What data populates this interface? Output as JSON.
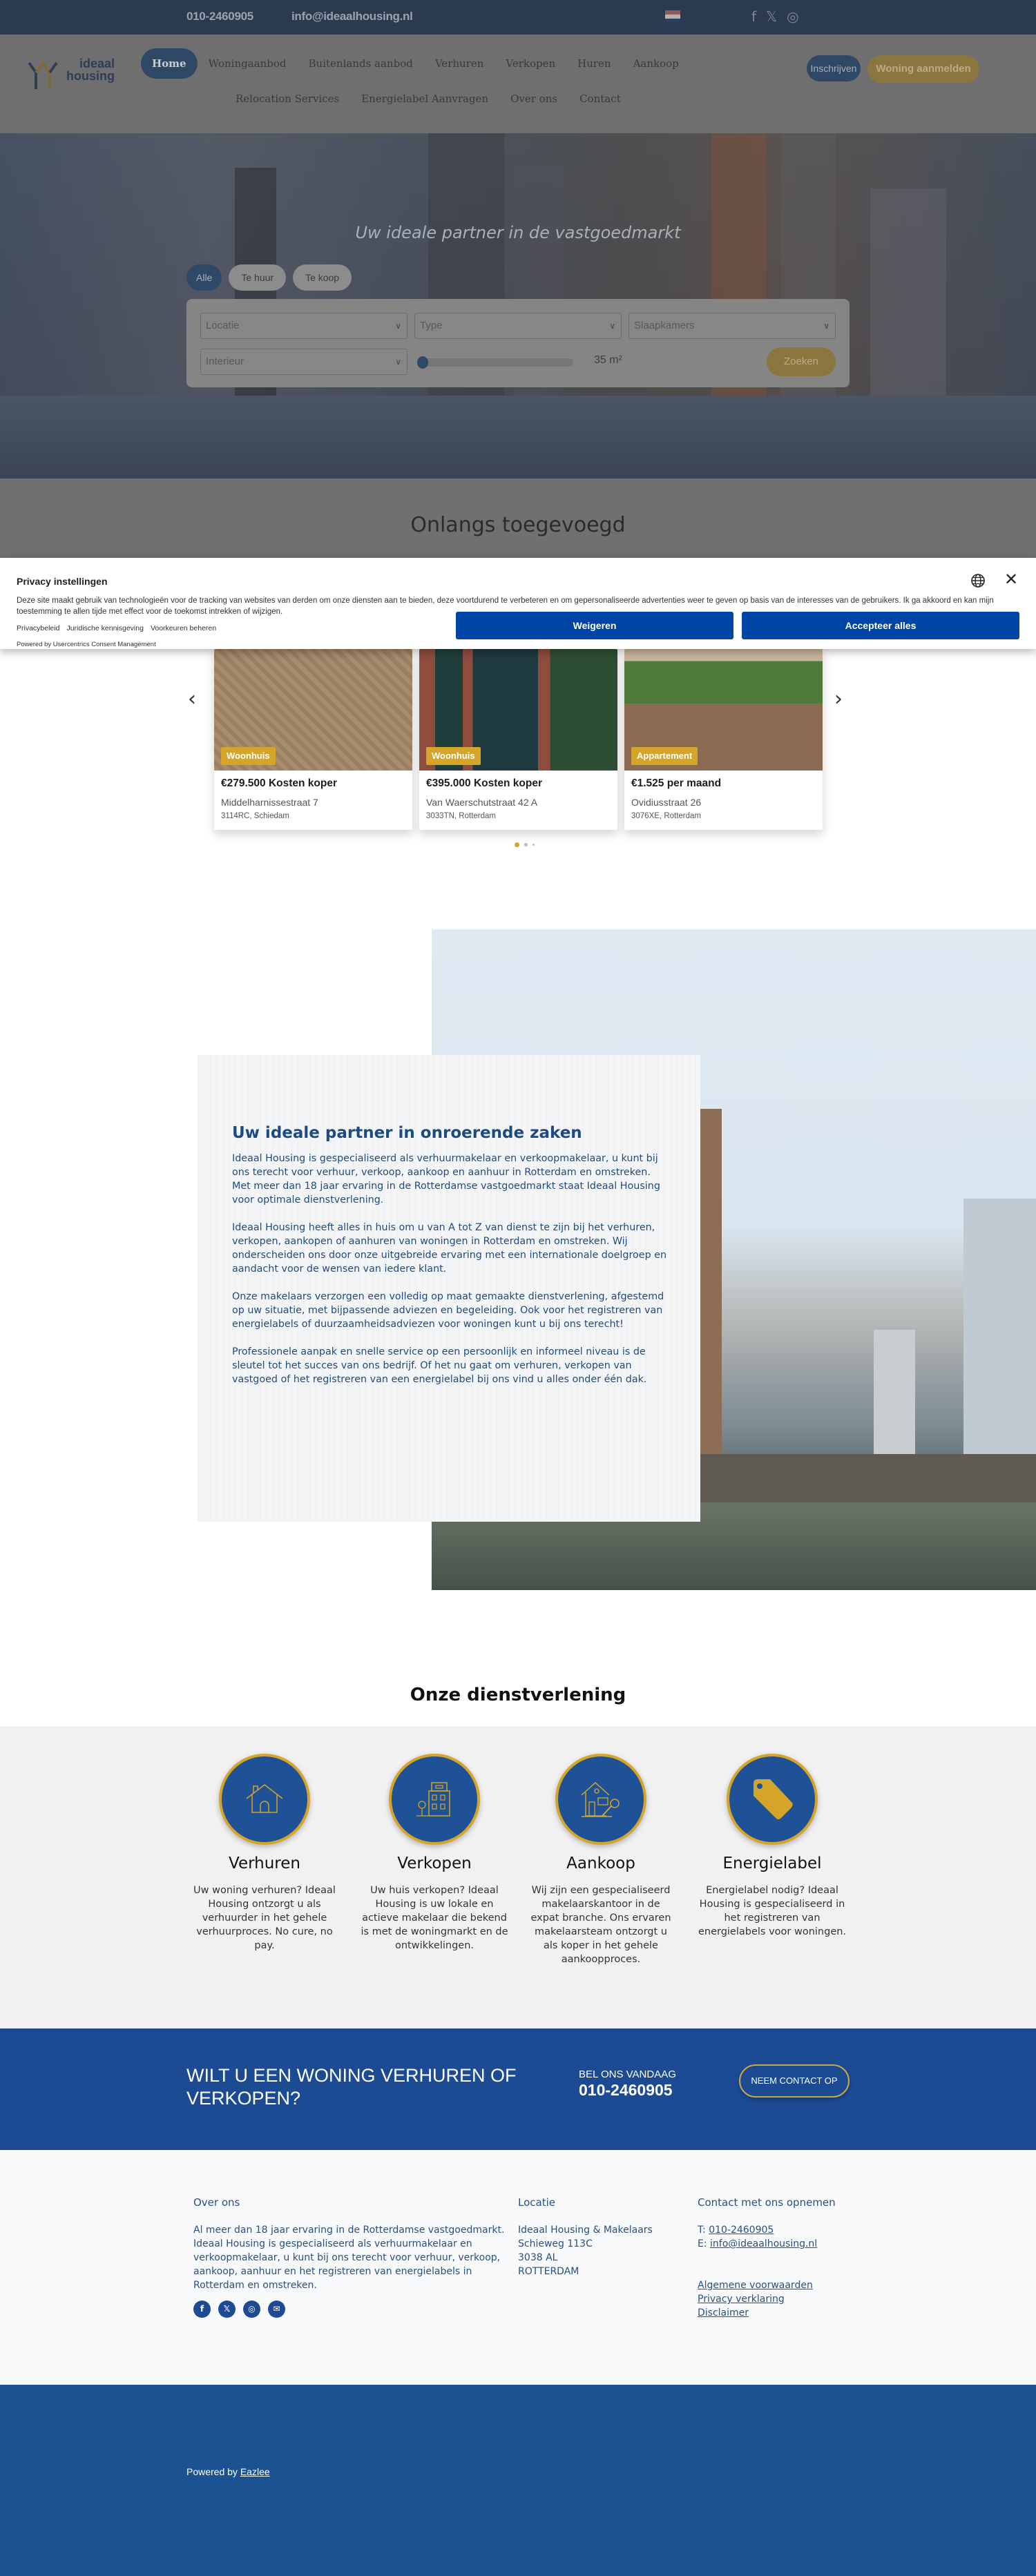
{
  "topbar": {
    "phone": "010-2460905",
    "email": "info@ideaalhousing.nl",
    "language_flag": "dutch-flag",
    "social": [
      {
        "name": "facebook",
        "glyph": "f"
      },
      {
        "name": "x",
        "glyph": "𝕏"
      },
      {
        "name": "instagram",
        "glyph": "◎"
      }
    ]
  },
  "header": {
    "logo_line1": "ideaal",
    "logo_line2": "housing",
    "nav_main": [
      "Home",
      "Woningaanbod",
      "Buitenlands aanbod",
      "Verhuren",
      "Verkopen",
      "Huren",
      "Aankoop"
    ],
    "nav_sub": [
      "Relocation Services",
      "Energielabel Aanvragen",
      "Over ons",
      "Contact"
    ],
    "active_nav": "Home",
    "btn_inschrijven": "Inschrijven",
    "btn_aanmelden": "Woning aanmelden"
  },
  "hero": {
    "title": "Uw ideale partner in de vastgoedmarkt",
    "tabs": [
      "Alle",
      "Te huur",
      "Te koop"
    ],
    "active_tab": "Alle",
    "filters": {
      "location_placeholder": "Locatie",
      "type_placeholder": "Type",
      "bedrooms_placeholder": "Slaapkamers",
      "interior_placeholder": "Interieur",
      "area_value": "35 m²",
      "search_label": "Zoeken"
    }
  },
  "recent": {
    "title": "Onlangs toegevoegd",
    "listings": [
      {
        "badge": "Woonhuis",
        "price": "€279.500 Kosten koper",
        "street": "Middelharnissestraat 7",
        "city": "3114RC, Schiedam"
      },
      {
        "badge": "Woonhuis",
        "price": "€395.000 Kosten koper",
        "street": "Van Waerschutstraat 42 A",
        "city": "3033TN, Rotterdam"
      },
      {
        "badge": "Appartement",
        "price": "€1.525 per maand",
        "street": "Ovidiusstraat 26",
        "city": "3076XE, Rotterdam"
      }
    ],
    "carousel_pages": 3,
    "carousel_active": 1
  },
  "consent": {
    "title": "Privacy instellingen",
    "text": "Deze site maakt gebruik van technologieën voor de tracking van websites van derden om onze diensten aan te bieden, deze voortdurend te verbeteren en om gepersonaliseerde advertenties weer te geven op basis van de interesses van de gebruikers. Ik ga akkoord en kan mijn toestemming te allen tijde met effect voor de toekomst intrekken of wijzigen.",
    "links": [
      "Privacybeleid",
      "Juridische kennisgeving",
      "Voorkeuren beheren"
    ],
    "powered": "Powered by Usercentrics Consent Management",
    "deny_label": "Weigeren",
    "accept_label": "Accepteer alles"
  },
  "about": {
    "title": "Uw ideale partner in onroerende zaken",
    "paragraphs": [
      "Ideaal Housing is gespecialiseerd als verhuurmakelaar en verkoopmakelaar, u kunt bij ons terecht voor verhuur, verkoop, aankoop en aanhuur in Rotterdam en omstreken. Met meer dan 18 jaar ervaring in de Rotterdamse vastgoedmarkt staat Ideaal Housing voor optimale dienstverlening.",
      "Ideaal Housing heeft alles in huis om u van A tot Z van dienst te zijn bij het verhuren, verkopen, aankopen of aanhuren van woningen in Rotterdam en omstreken. Wij onderscheiden ons door onze uitgebreide ervaring met een internationale doelgroep en aandacht voor de wensen van iedere klant.",
      "Onze makelaars verzorgen een volledig op maat gemaakte dienstverlening, afgestemd op uw situatie, met bijpassende adviezen en begeleiding. Ook voor het registreren van energielabels of duurzaamheidsadviezen voor woningen kunt u bij ons terecht!",
      "Professionele aanpak en snelle service op een persoonlijk en informeel niveau is de sleutel tot het succes van ons bedrijf. Of het nu gaat om verhuren, verkopen van vastgoed of het registreren van een energielabel bij ons vind u alles onder één dak."
    ]
  },
  "services": {
    "title": "Onze dienstverlening",
    "items": [
      {
        "name": "Verhuren",
        "icon": "house-icon",
        "desc": "Uw woning verhuren? Ideaal Housing ontzorgt u als verhuurder in het gehele verhuurproces. No cure, no pay."
      },
      {
        "name": "Verkopen",
        "icon": "building-icon",
        "desc": "Uw huis verkopen? Ideaal Housing is uw lokale en actieve makelaar die bekend is met de woningmarkt en de ontwikkelingen."
      },
      {
        "name": "Aankoop",
        "icon": "house-key-icon",
        "desc": "Wij zijn een gespecialiseerd makelaarskantoor in de expat branche. Ons ervaren makelaarsteam ontzorgt u als koper in het gehele aankoopproces."
      },
      {
        "name": "Energielabel",
        "icon": "tag-icon",
        "desc": "Energielabel nodig? Ideaal Housing is gespecialiseerd in het registreren van energielabels voor woningen."
      }
    ]
  },
  "cta": {
    "title": "WILT U EEN WONING VERHUREN OF VERKOPEN?",
    "call_label": "BEL ONS VANDAAG",
    "phone": "010-2460905",
    "button": "NEEM CONTACT OP"
  },
  "footer": {
    "about_heading": "Over ons",
    "about_text": "Al meer dan 18 jaar ervaring in de Rotterdamse vastgoedmarkt. Ideaal Housing is gespecialiseerd als verhuurmakelaar en verkoopmakelaar, u kunt bij ons terecht voor verhuur, verkoop, aankoop, aanhuur en het registreren van energielabels in Rotterdam en omstreken.",
    "social": [
      "f",
      "𝕏",
      "◎",
      "✉"
    ],
    "location_heading": "Locatie",
    "address": [
      "Ideaal Housing & Makelaars",
      "Schieweg 113C",
      "3038 AL",
      "ROTTERDAM"
    ],
    "contact_heading": "Contact met ons opnemen",
    "phone_prefix": "T:",
    "phone": "010-2460905",
    "email_prefix": "E:",
    "email": "info@ideaalhousing.nl",
    "links": [
      "Algemene voorwaarden",
      "Privacy verklaring",
      "Disclaimer"
    ],
    "powered_prefix": "Powered by",
    "powered_link": "Eazlee"
  },
  "colors": {
    "brand_blue": "#1c4b94",
    "brand_gold": "#d4a529",
    "consent_blue": "#0045a5",
    "text_blue": "#1f4a80"
  }
}
